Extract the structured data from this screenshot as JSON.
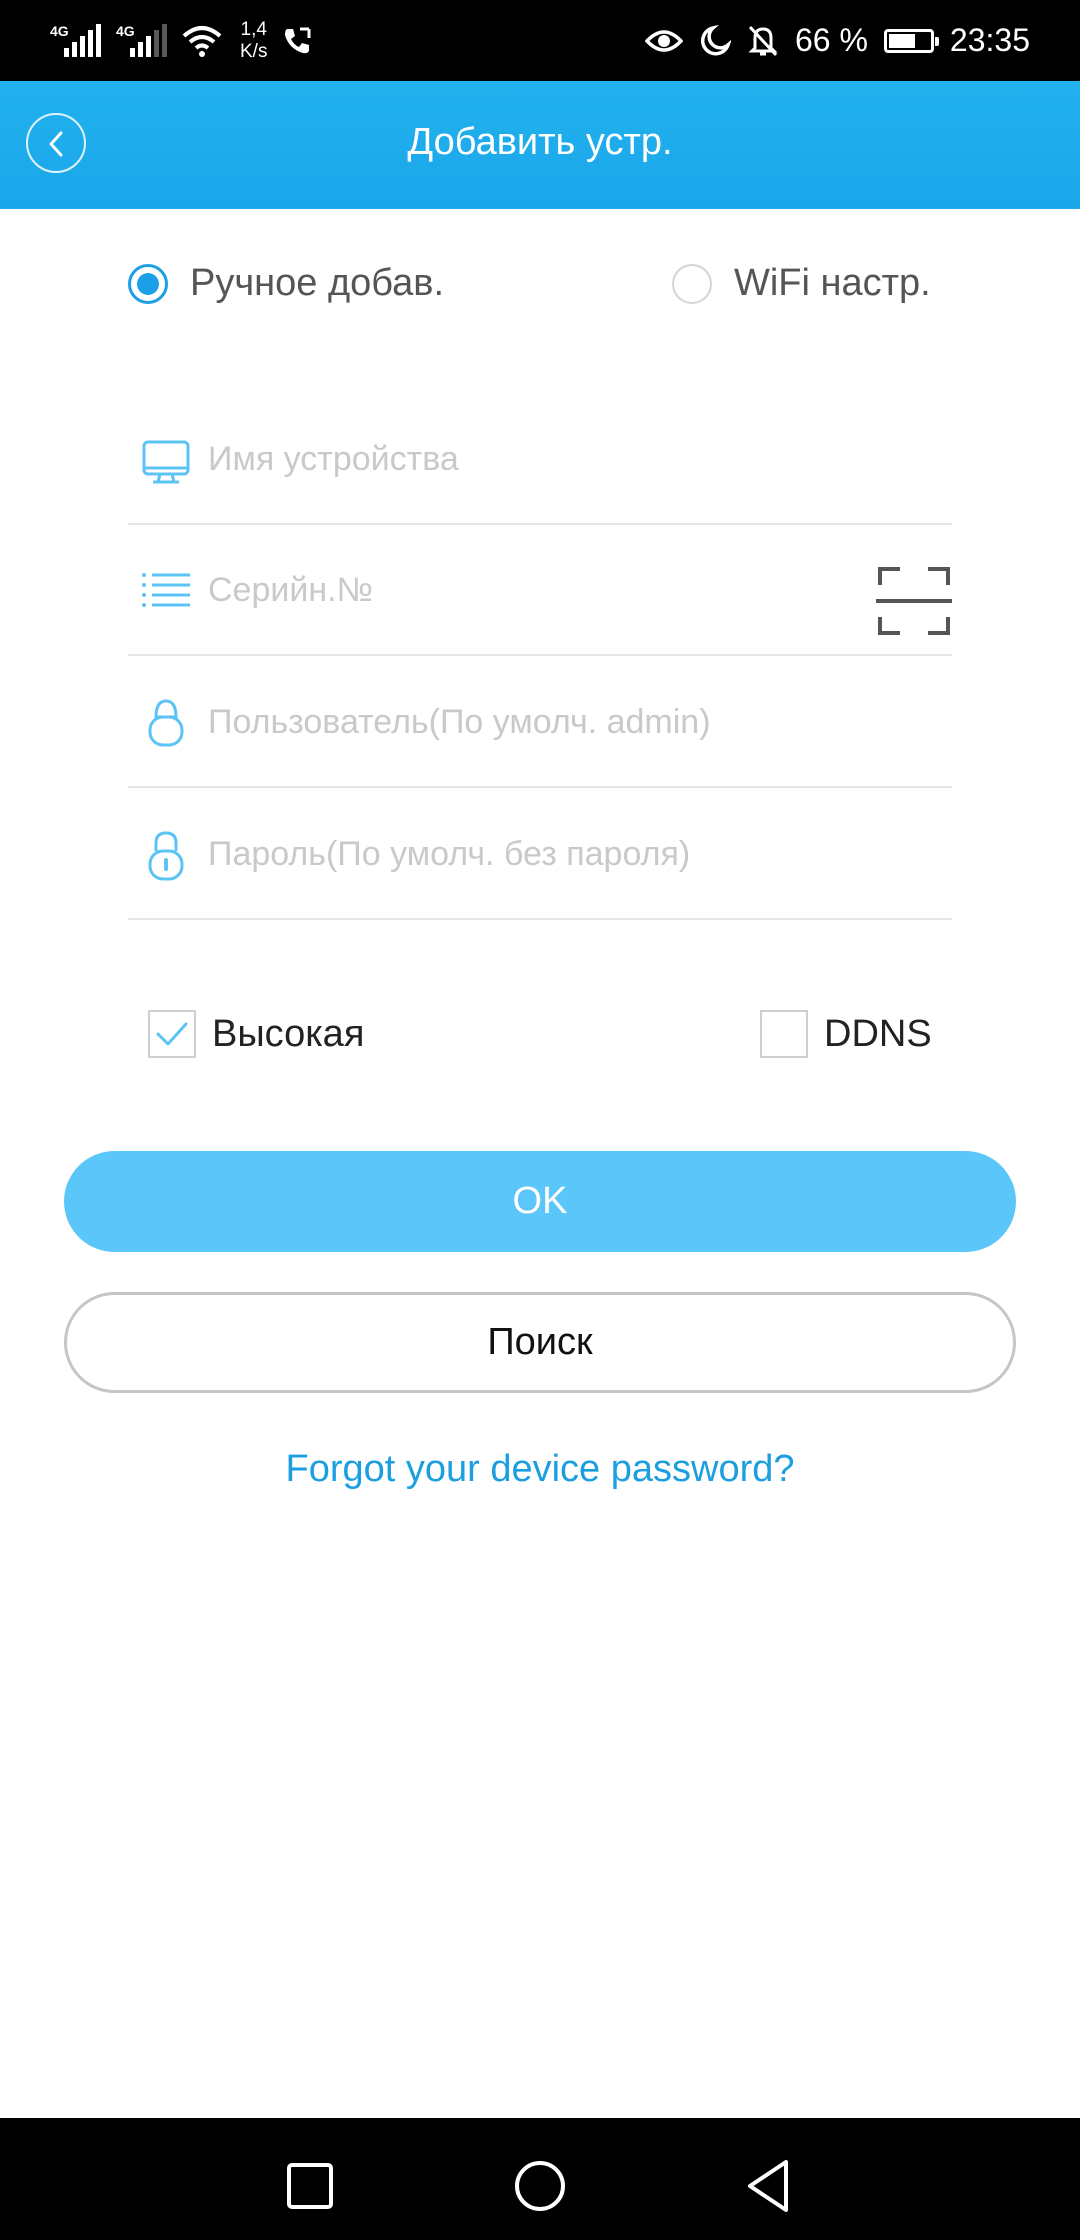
{
  "status_bar": {
    "net1": "4G",
    "net2": "4G",
    "speed_value": "1,4",
    "speed_unit": "K/s",
    "battery_percent": "66 %",
    "battery_level": 0.66,
    "time": "23:35",
    "icons": [
      "signal-icon",
      "signal-icon",
      "wifi-icon",
      "call-icon",
      "eye-icon",
      "moon-icon",
      "bell-off-icon",
      "battery-icon"
    ]
  },
  "header": {
    "title": "Добавить устр.",
    "back_icon": "chevron-left-icon"
  },
  "mode": {
    "options": [
      {
        "label": "Ручное добав.",
        "selected": true
      },
      {
        "label": "WiFi настр.",
        "selected": false
      }
    ]
  },
  "form": {
    "device_name": {
      "placeholder": "Имя устройства",
      "value": "",
      "icon": "monitor-icon"
    },
    "serial": {
      "placeholder": "Серийн.№",
      "value": "",
      "icon": "list-icon",
      "scan_icon": "scan-qr-icon"
    },
    "user": {
      "placeholder": "Пользователь(По умолч. admin)",
      "value": "",
      "icon": "user-icon"
    },
    "password": {
      "placeholder": "Пароль(По умолч. без пароля)",
      "value": "",
      "icon": "lock-icon"
    }
  },
  "options": {
    "high": {
      "label": "Высокая",
      "checked": true
    },
    "ddns": {
      "label": "DDNS",
      "checked": false
    }
  },
  "buttons": {
    "ok": "OK",
    "search": "Поиск"
  },
  "forgot_link": "Forgot your device password?",
  "colors": {
    "header": "#1aa6ea",
    "accent": "#1c9fe6",
    "ok_button": "#5bc6f9",
    "link": "#1b9fe0",
    "icon_blue": "#5cc3f5"
  },
  "nav_bar": {
    "icons": [
      "recent-apps-icon",
      "home-icon",
      "back-icon"
    ]
  }
}
